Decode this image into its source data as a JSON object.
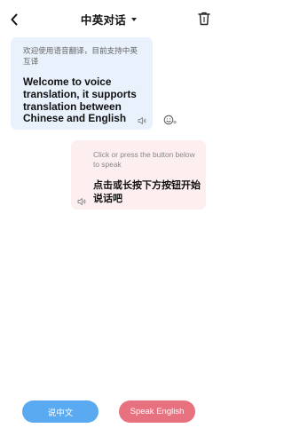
{
  "header": {
    "title": "中英对话",
    "back_icon": "chevron-left-icon",
    "dropdown_icon": "caret-down-icon",
    "trash_icon": "trash-icon"
  },
  "messages": [
    {
      "side": "left",
      "source_text": "欢迎使用语音翻译，目前支持中英互译",
      "translated_text": "Welcome to voice translation, it supports translation between Chinese and English",
      "bubble_color": "#e8f1fc",
      "speaker_icon": "speaker-icon",
      "copy_icon": "copy-emoji-icon"
    },
    {
      "side": "right",
      "source_text": "Click or press the button below to speak",
      "translated_text": "点击或长按下方按钮开始说话吧",
      "bubble_color": "#fdeef0",
      "speaker_icon": "speaker-icon"
    }
  ],
  "buttons": {
    "speak_chinese": "说中文",
    "speak_english": "Speak English",
    "chinese_color": "#5aaaf2",
    "english_color": "#e8717f"
  }
}
